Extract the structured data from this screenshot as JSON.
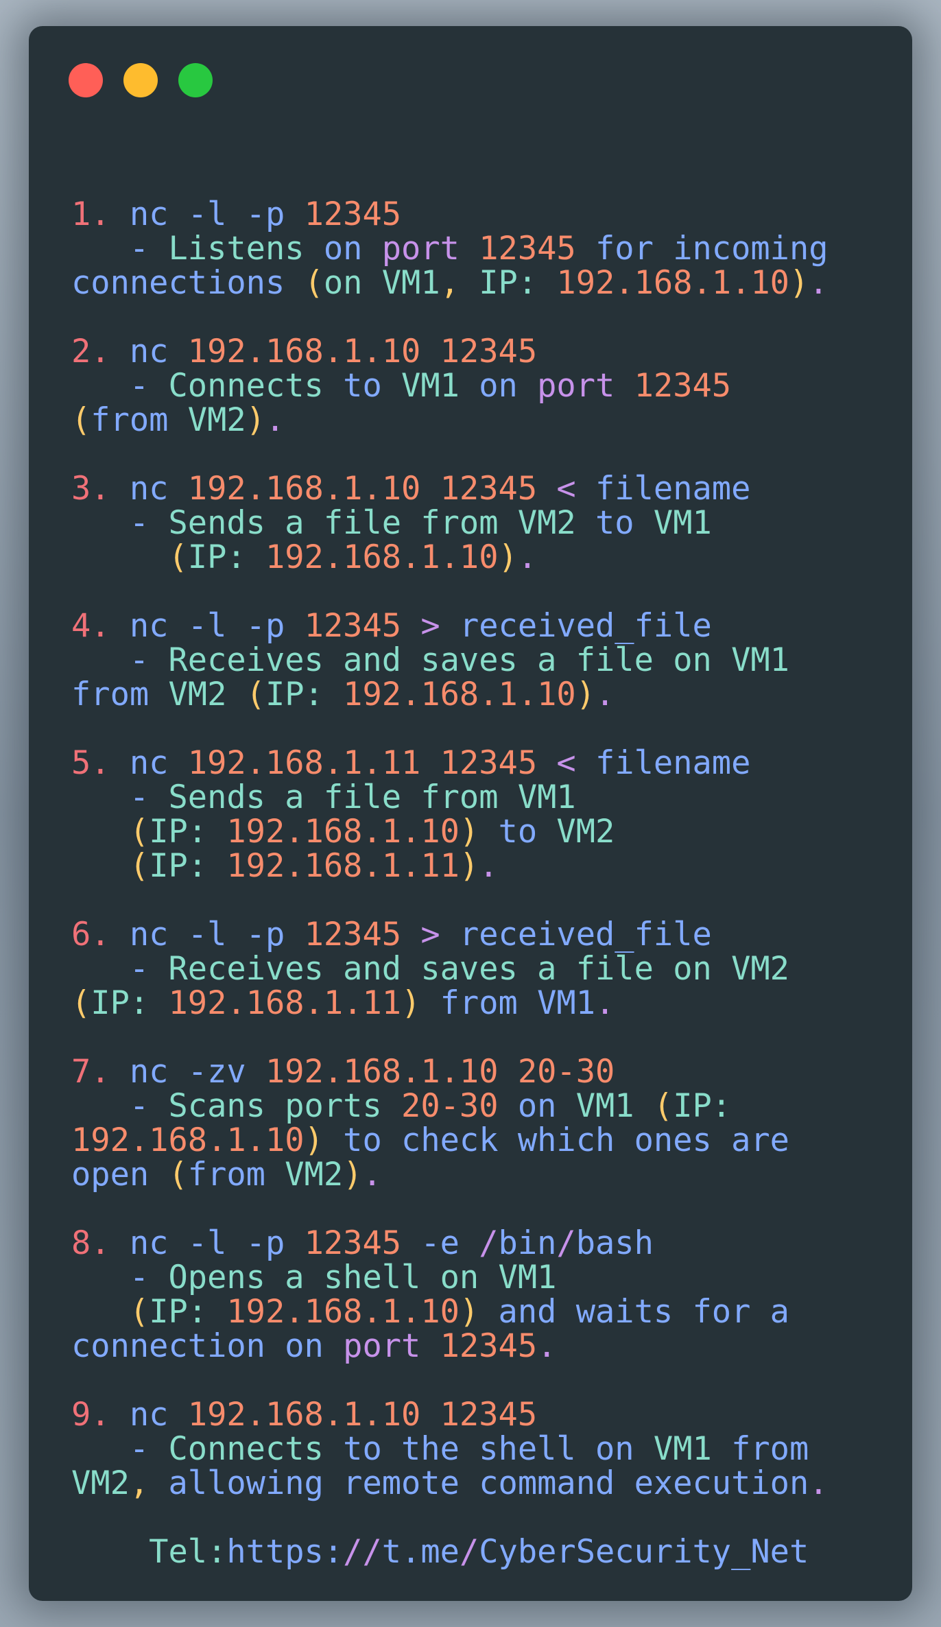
{
  "window": {
    "controls": [
      "close",
      "minimize",
      "maximize"
    ],
    "colors": {
      "close": "#ff5f57",
      "minimize": "#febc2e",
      "maximize": "#28c840",
      "background": "#263238"
    }
  },
  "code_lines": [
    [],
    [
      [
        "1. ",
        "red"
      ],
      [
        "nc -l -p ",
        "blue"
      ],
      [
        "12345",
        "num"
      ]
    ],
    [
      [
        "   - ",
        "blue"
      ],
      [
        "Listens ",
        "teal"
      ],
      [
        "on ",
        "blue"
      ],
      [
        "port ",
        "purple"
      ],
      [
        "12345 ",
        "num"
      ],
      [
        "for incoming",
        "blue"
      ]
    ],
    [
      [
        "connections ",
        "blue"
      ],
      [
        "(",
        "yellow"
      ],
      [
        "on VM1",
        "teal"
      ],
      [
        ", ",
        "yellow"
      ],
      [
        "IP: ",
        "teal"
      ],
      [
        "192.168.1.10",
        "num"
      ],
      [
        ")",
        "yellow"
      ],
      [
        ".",
        "purple"
      ]
    ],
    [],
    [
      [
        "2. ",
        "red"
      ],
      [
        "nc ",
        "blue"
      ],
      [
        "192.168.1.10 12345",
        "num"
      ]
    ],
    [
      [
        "   - ",
        "blue"
      ],
      [
        "Connects ",
        "teal"
      ],
      [
        "to ",
        "blue"
      ],
      [
        "VM1 ",
        "teal"
      ],
      [
        "on ",
        "blue"
      ],
      [
        "port ",
        "purple"
      ],
      [
        "12345",
        "num"
      ]
    ],
    [
      [
        "(",
        "yellow"
      ],
      [
        "from ",
        "blue"
      ],
      [
        "VM2",
        "teal"
      ],
      [
        ")",
        "yellow"
      ],
      [
        ".",
        "purple"
      ]
    ],
    [],
    [
      [
        "3. ",
        "red"
      ],
      [
        "nc ",
        "blue"
      ],
      [
        "192.168.1.10 12345 ",
        "num"
      ],
      [
        "< ",
        "purple"
      ],
      [
        "filename",
        "blue"
      ]
    ],
    [
      [
        "   - ",
        "blue"
      ],
      [
        "Sends a file from ",
        "teal"
      ],
      [
        "VM2 ",
        "teal"
      ],
      [
        "to ",
        "blue"
      ],
      [
        "VM1",
        "teal"
      ]
    ],
    [
      [
        "     (",
        "yellow"
      ],
      [
        "IP: ",
        "teal"
      ],
      [
        "192.168.1.10",
        "num"
      ],
      [
        ")",
        "yellow"
      ],
      [
        ".",
        "purple"
      ]
    ],
    [],
    [
      [
        "4. ",
        "red"
      ],
      [
        "nc -l -p ",
        "blue"
      ],
      [
        "12345 ",
        "num"
      ],
      [
        "> ",
        "purple"
      ],
      [
        "received_file",
        "blue"
      ]
    ],
    [
      [
        "   - ",
        "blue"
      ],
      [
        "Receives and saves a file on VM1",
        "teal"
      ]
    ],
    [
      [
        "from ",
        "blue"
      ],
      [
        "VM2 ",
        "teal"
      ],
      [
        "(",
        "yellow"
      ],
      [
        "IP: ",
        "teal"
      ],
      [
        "192.168.1.10",
        "num"
      ],
      [
        ")",
        "yellow"
      ],
      [
        ".",
        "purple"
      ]
    ],
    [],
    [
      [
        "5. ",
        "red"
      ],
      [
        "nc ",
        "blue"
      ],
      [
        "192.168.1.11 12345 ",
        "num"
      ],
      [
        "< ",
        "purple"
      ],
      [
        "filename",
        "blue"
      ]
    ],
    [
      [
        "   - ",
        "blue"
      ],
      [
        "Sends a file from VM1",
        "teal"
      ]
    ],
    [
      [
        "   (",
        "yellow"
      ],
      [
        "IP: ",
        "teal"
      ],
      [
        "192.168.1.10",
        "num"
      ],
      [
        ") ",
        "yellow"
      ],
      [
        "to ",
        "blue"
      ],
      [
        "VM2",
        "teal"
      ]
    ],
    [
      [
        "   (",
        "yellow"
      ],
      [
        "IP: ",
        "teal"
      ],
      [
        "192.168.1.11",
        "num"
      ],
      [
        ")",
        "yellow"
      ],
      [
        ".",
        "purple"
      ]
    ],
    [],
    [
      [
        "6. ",
        "red"
      ],
      [
        "nc -l -p ",
        "blue"
      ],
      [
        "12345 ",
        "num"
      ],
      [
        "> ",
        "purple"
      ],
      [
        "received_file",
        "blue"
      ]
    ],
    [
      [
        "   - ",
        "blue"
      ],
      [
        "Receives and saves a file on VM2",
        "teal"
      ]
    ],
    [
      [
        "(",
        "yellow"
      ],
      [
        "IP: ",
        "teal"
      ],
      [
        "192.168.1.11",
        "num"
      ],
      [
        ") ",
        "yellow"
      ],
      [
        "from VM1",
        "blue"
      ],
      [
        ".",
        "purple"
      ]
    ],
    [],
    [
      [
        "7. ",
        "red"
      ],
      [
        "nc -zv ",
        "blue"
      ],
      [
        "192.168.1.10 20-30",
        "num"
      ]
    ],
    [
      [
        "   - ",
        "blue"
      ],
      [
        "Scans ports ",
        "teal"
      ],
      [
        "20-30 ",
        "num"
      ],
      [
        "on ",
        "blue"
      ],
      [
        "VM1 ",
        "teal"
      ],
      [
        "(",
        "yellow"
      ],
      [
        "IP:",
        "teal"
      ]
    ],
    [
      [
        "192.168.1.10",
        "num"
      ],
      [
        ") ",
        "yellow"
      ],
      [
        "to check which ones are",
        "blue"
      ]
    ],
    [
      [
        "open ",
        "blue"
      ],
      [
        "(",
        "yellow"
      ],
      [
        "from ",
        "blue"
      ],
      [
        "VM2",
        "teal"
      ],
      [
        ")",
        "yellow"
      ],
      [
        ".",
        "purple"
      ]
    ],
    [],
    [
      [
        "8. ",
        "red"
      ],
      [
        "nc -l -p ",
        "blue"
      ],
      [
        "12345 ",
        "num"
      ],
      [
        "-e ",
        "blue"
      ],
      [
        "/",
        "purple"
      ],
      [
        "bin",
        "blue"
      ],
      [
        "/",
        "purple"
      ],
      [
        "bash",
        "blue"
      ]
    ],
    [
      [
        "   - ",
        "blue"
      ],
      [
        "Opens a shell on VM1",
        "teal"
      ]
    ],
    [
      [
        "   (",
        "yellow"
      ],
      [
        "IP: ",
        "teal"
      ],
      [
        "192.168.1.10",
        "num"
      ],
      [
        ") ",
        "yellow"
      ],
      [
        "and waits for a",
        "blue"
      ]
    ],
    [
      [
        "connection on ",
        "blue"
      ],
      [
        "port ",
        "purple"
      ],
      [
        "12345",
        "num"
      ],
      [
        ".",
        "purple"
      ]
    ],
    [],
    [
      [
        "9. ",
        "red"
      ],
      [
        "nc ",
        "blue"
      ],
      [
        "192.168.1.10 12345",
        "num"
      ]
    ],
    [
      [
        "   - ",
        "blue"
      ],
      [
        "Connects ",
        "teal"
      ],
      [
        "to the shell on ",
        "blue"
      ],
      [
        "VM1 ",
        "teal"
      ],
      [
        "from",
        "blue"
      ]
    ],
    [
      [
        "VM2",
        "teal"
      ],
      [
        ", ",
        "yellow"
      ],
      [
        "allowing remote command execution",
        "blue"
      ],
      [
        ".",
        "purple"
      ]
    ],
    [],
    [
      [
        "    Tel:",
        "teal"
      ],
      [
        "https:",
        "blue"
      ],
      [
        "//",
        "purple"
      ],
      [
        "t.me",
        "blue"
      ],
      [
        "/",
        "purple"
      ],
      [
        "CyberSecurity_Net",
        "blue"
      ]
    ]
  ]
}
